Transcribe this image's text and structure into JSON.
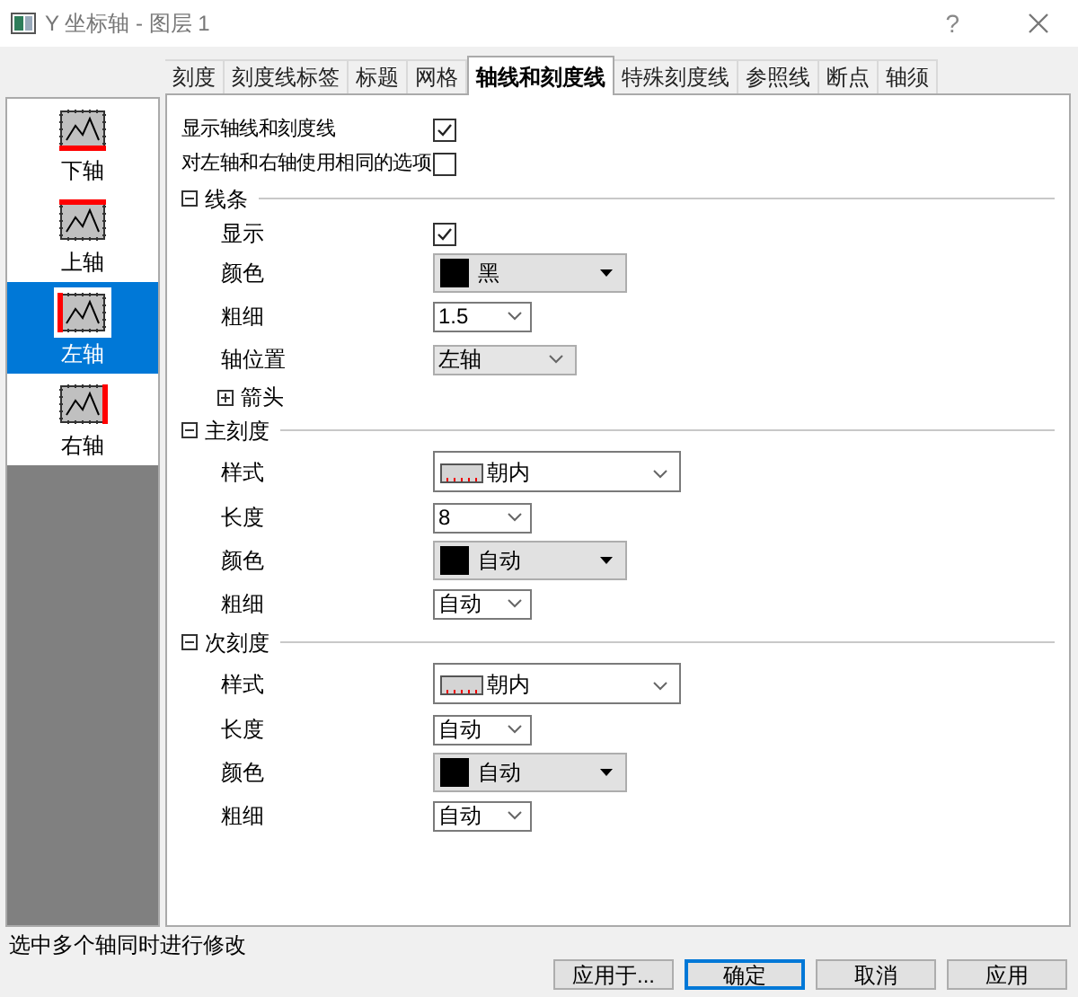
{
  "window": {
    "title": "Y 坐标轴 - 图层 1",
    "help": "?"
  },
  "tabs": [
    {
      "label": "刻度",
      "selected": false
    },
    {
      "label": "刻度线标签",
      "selected": false
    },
    {
      "label": "标题",
      "selected": false
    },
    {
      "label": "网格",
      "selected": false
    },
    {
      "label": "轴线和刻度线",
      "selected": true
    },
    {
      "label": "特殊刻度线",
      "selected": false
    },
    {
      "label": "参照线",
      "selected": false
    },
    {
      "label": "断点",
      "selected": false
    },
    {
      "label": "轴须",
      "selected": false
    }
  ],
  "axes": [
    {
      "label": "下轴",
      "kind": "bottom",
      "selected": false
    },
    {
      "label": "上轴",
      "kind": "top",
      "selected": false
    },
    {
      "label": "左轴",
      "kind": "left",
      "selected": true
    },
    {
      "label": "右轴",
      "kind": "right",
      "selected": false
    }
  ],
  "options": [
    {
      "label": "显示轴线和刻度线",
      "checked": true
    },
    {
      "label": "对左轴和右轴使用相同的选项",
      "checked": false
    }
  ],
  "sections": [
    {
      "title": "线条",
      "expanded": true,
      "rows": [
        {
          "kind": "checkbox",
          "label": "显示",
          "checked": true
        },
        {
          "kind": "color",
          "label": "颜色",
          "value": "黑",
          "color": "#000000"
        },
        {
          "kind": "combo",
          "label": "粗细",
          "value": "1.5"
        },
        {
          "kind": "dropdown",
          "label": "轴位置",
          "value": "左轴"
        },
        {
          "kind": "group",
          "label": "箭头",
          "expanded": false
        }
      ]
    },
    {
      "title": "主刻度",
      "expanded": true,
      "rows": [
        {
          "kind": "style",
          "label": "样式",
          "value": "朝内"
        },
        {
          "kind": "combo",
          "label": "长度",
          "value": "8"
        },
        {
          "kind": "color",
          "label": "颜色",
          "value": "自动",
          "color": "#000000"
        },
        {
          "kind": "combo",
          "label": "粗细",
          "value": "自动"
        }
      ]
    },
    {
      "title": "次刻度",
      "expanded": true,
      "rows": [
        {
          "kind": "style",
          "label": "样式",
          "value": "朝内"
        },
        {
          "kind": "combo",
          "label": "长度",
          "value": "自动"
        },
        {
          "kind": "color",
          "label": "颜色",
          "value": "自动",
          "color": "#000000"
        },
        {
          "kind": "combo",
          "label": "粗细",
          "value": "自动"
        }
      ]
    }
  ],
  "status": "选中多个轴同时进行修改",
  "buttons": [
    {
      "label": "应用于...",
      "default": false
    },
    {
      "label": "确定",
      "default": true
    },
    {
      "label": "取消",
      "default": false
    },
    {
      "label": "应用",
      "default": false
    }
  ]
}
